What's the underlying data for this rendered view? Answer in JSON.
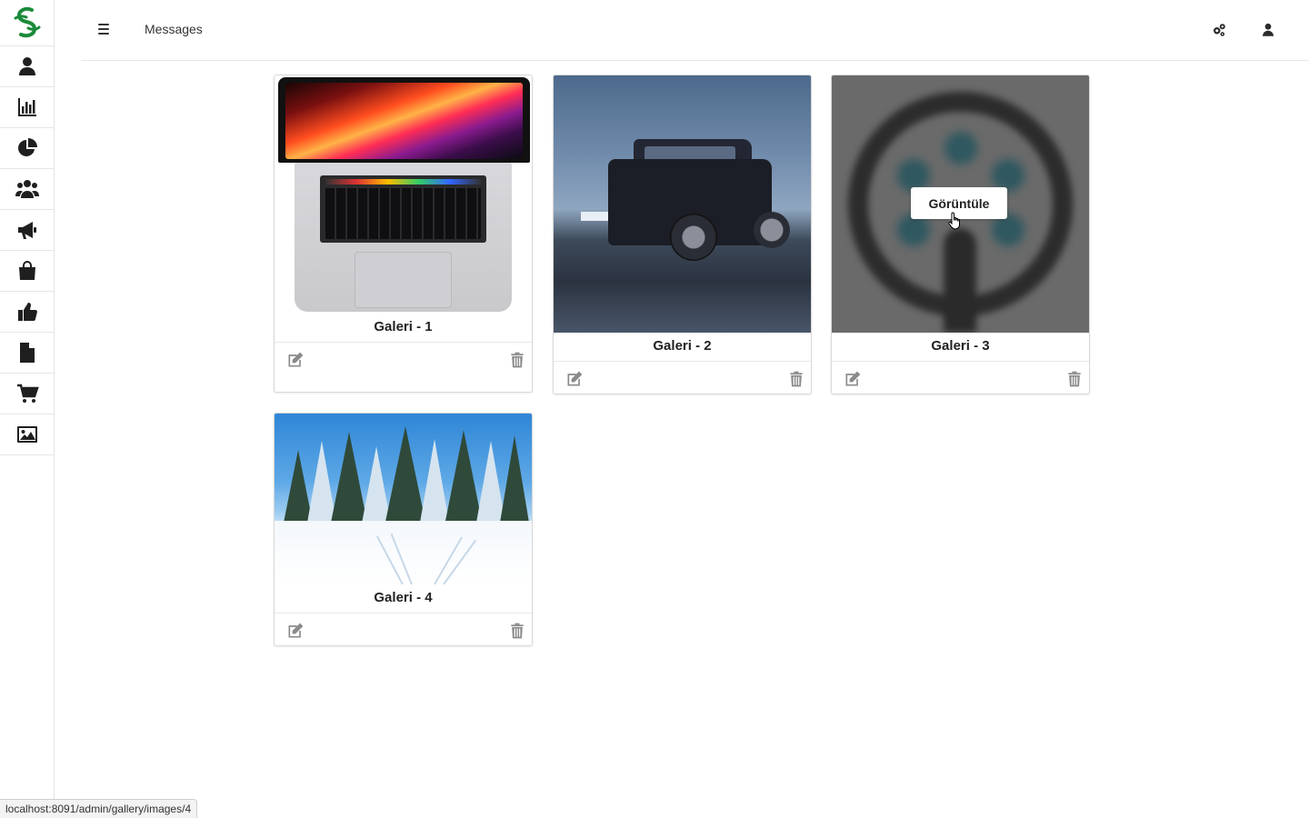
{
  "header": {
    "title": "Messages",
    "menu_icon": "hamburger-icon",
    "right_icons": [
      "gears-icon",
      "user-icon"
    ]
  },
  "sidebar": {
    "logo": "brand-logo",
    "items": [
      {
        "icon": "user-icon"
      },
      {
        "icon": "bar-chart-icon"
      },
      {
        "icon": "pie-chart-icon"
      },
      {
        "icon": "users-icon"
      },
      {
        "icon": "megaphone-icon"
      },
      {
        "icon": "shopping-bag-icon"
      },
      {
        "icon": "thumbs-up-icon"
      },
      {
        "icon": "file-icon"
      },
      {
        "icon": "cart-icon"
      },
      {
        "icon": "image-icon"
      }
    ]
  },
  "gallery": {
    "items": [
      {
        "title": "Galeri - 1",
        "image": "laptop"
      },
      {
        "title": "Galeri - 2",
        "image": "suv"
      },
      {
        "title": "Galeri - 3",
        "image": "logo",
        "hover_label": "Görüntüle"
      },
      {
        "title": "Galeri - 4",
        "image": "snow-forest"
      }
    ],
    "edit_icon": "edit-icon",
    "delete_icon": "trash-icon"
  },
  "statusbar": {
    "url": "localhost:8091/admin/gallery/images/4"
  },
  "colors": {
    "brand": "#1a8a3a",
    "icon": "#1f1f1f",
    "muted_icon": "#8a8a8a"
  }
}
